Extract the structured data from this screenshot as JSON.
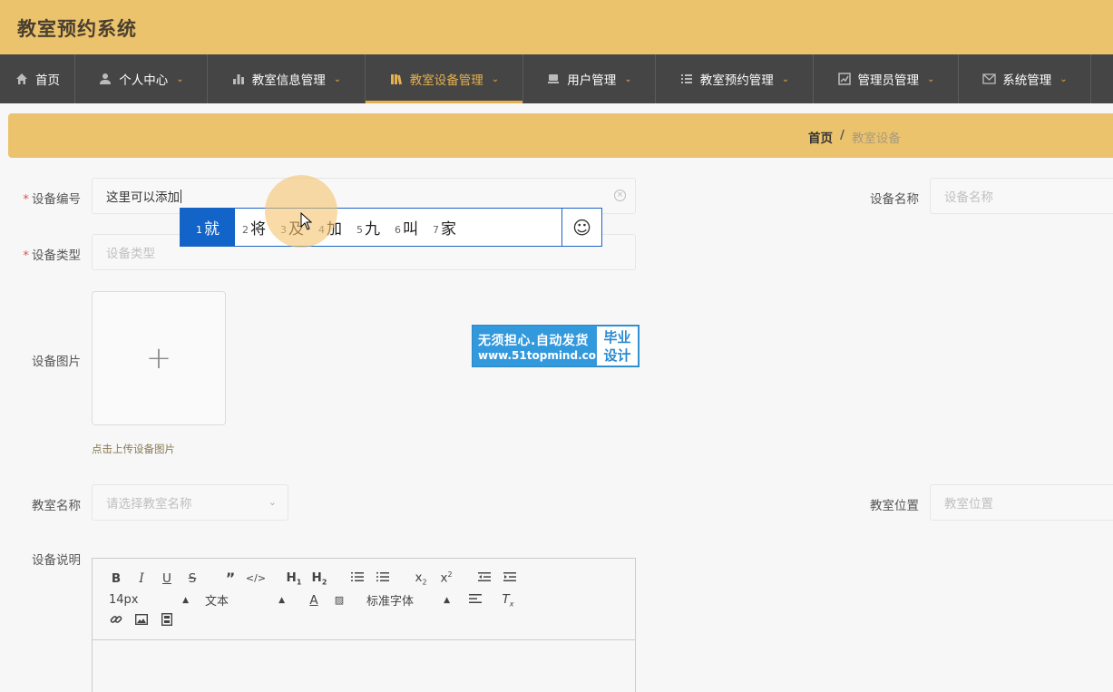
{
  "app": {
    "title": "教室预约系统"
  },
  "nav": {
    "items": [
      {
        "label": "首页",
        "icon": "home-icon"
      },
      {
        "label": "个人中心",
        "icon": "user-icon"
      },
      {
        "label": "教室信息管理",
        "icon": "bar-chart-icon"
      },
      {
        "label": "教室设备管理",
        "icon": "book-icon",
        "active": true
      },
      {
        "label": "用户管理",
        "icon": "monitor-icon"
      },
      {
        "label": "教室预约管理",
        "icon": "list-icon"
      },
      {
        "label": "管理员管理",
        "icon": "trend-chart-icon"
      },
      {
        "label": "系统管理",
        "icon": "mail-icon"
      }
    ]
  },
  "breadcrumb": {
    "home": "首页",
    "separator": "/",
    "current": "教室设备"
  },
  "form": {
    "device_no": {
      "label": "设备编号",
      "value": "这里可以添加"
    },
    "device_name": {
      "label": "设备名称",
      "placeholder": "设备名称"
    },
    "device_type": {
      "label": "设备类型",
      "placeholder": "设备类型"
    },
    "device_image": {
      "label": "设备图片",
      "hint": "点击上传设备图片",
      "plus": "+"
    },
    "classroom_name": {
      "label": "教室名称",
      "placeholder": "请选择教室名称"
    },
    "classroom_location": {
      "label": "教室位置",
      "placeholder": "教室位置"
    },
    "description": {
      "label": "设备说明"
    }
  },
  "ime": {
    "candidates": [
      {
        "n": "1",
        "text": "就"
      },
      {
        "n": "2",
        "text": "将"
      },
      {
        "n": "3",
        "text": "及"
      },
      {
        "n": "4",
        "text": "加"
      },
      {
        "n": "5",
        "text": "九"
      },
      {
        "n": "6",
        "text": "叫"
      },
      {
        "n": "7",
        "text": "家"
      }
    ],
    "emoji": "☺"
  },
  "ad": {
    "line1": "无须担心.自动发货",
    "line2": "www.51topmind.com",
    "right1": "毕业",
    "right2": "设计"
  },
  "editor": {
    "font_size": "14px",
    "paragraph": "文本",
    "font_family": "标准字体"
  },
  "colors": {
    "topbar": "#ecc36d",
    "navbar": "#454545",
    "accent": "#e5b14e",
    "ime_selected": "#1364c8"
  }
}
